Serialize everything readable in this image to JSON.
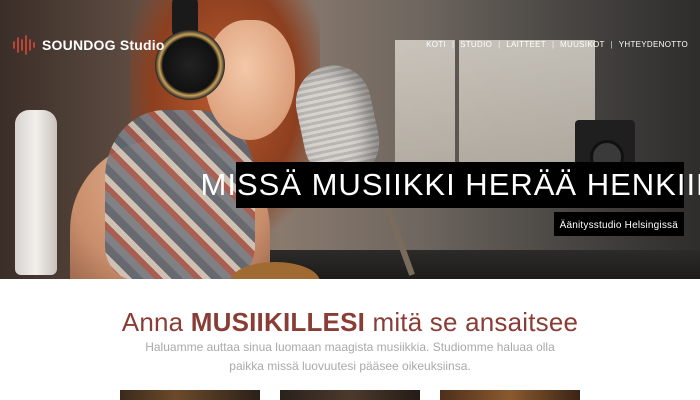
{
  "brand": {
    "name": "SOUNDOG Studio",
    "logo_icon": "waveform-logo-icon",
    "accent": "#8a3d35"
  },
  "nav": {
    "items": [
      {
        "label": "KOTI"
      },
      {
        "label": "STUDIO"
      },
      {
        "label": "LAITTEET"
      },
      {
        "label": "MUUSIKOT"
      },
      {
        "label": "YHTEYDENOTTO"
      }
    ],
    "separator": "|"
  },
  "hero": {
    "headline": "MISSÄ MUSIIKKI HERÄÄ HENKIIN",
    "subheadline": "Äänitysstudio Helsingissä"
  },
  "intro": {
    "title_pre": "Anna ",
    "title_strong": "MUSIIKILLESI",
    "title_post": " mitä se ansaitsee",
    "text_line1": "Haluamme auttaa sinua luomaan maagista musiikkia. Studiomme haluaa olla",
    "text_line2": "paikka missä luovuutesi pääsee oikeuksiinsa."
  }
}
